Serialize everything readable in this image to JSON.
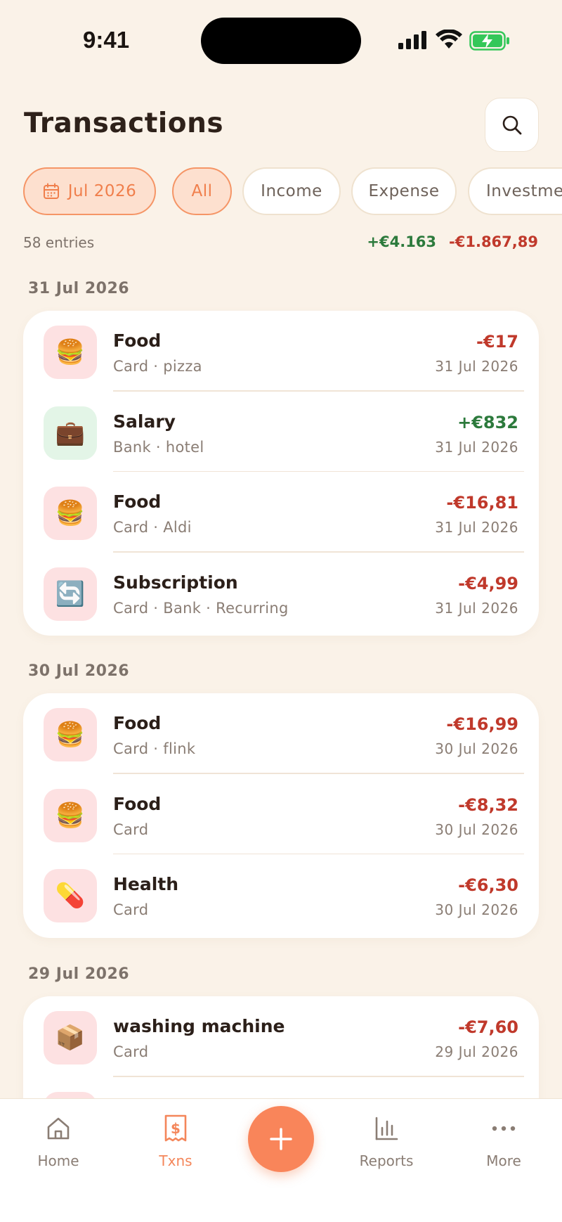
{
  "status_bar": {
    "time": "9:41"
  },
  "header": {
    "title": "Transactions"
  },
  "filters": {
    "month": "Jul 2026",
    "chips": [
      "All",
      "Income",
      "Expense",
      "Investme"
    ]
  },
  "summary": {
    "entries": "58 entries",
    "income": "+€4.163",
    "expense": "-€1.867,89"
  },
  "groups": [
    {
      "date": "31 Jul 2026",
      "items": [
        {
          "icon": "🍔",
          "icon_name": "burger-icon",
          "name": "Food",
          "sub": "Card · pizza",
          "amount": "-€17",
          "type": "neg",
          "date": "31 Jul 2026"
        },
        {
          "icon": "💼",
          "icon_name": "briefcase-icon",
          "name": "Salary",
          "sub": "Bank · hotel",
          "amount": "+€832",
          "type": "pos",
          "date": "31 Jul 2026"
        },
        {
          "icon": "🍔",
          "icon_name": "burger-icon",
          "name": "Food",
          "sub": "Card · Aldi",
          "amount": "-€16,81",
          "type": "neg",
          "date": "31 Jul 2026"
        },
        {
          "icon": "🔄",
          "icon_name": "recurring-icon",
          "name": "Subscription",
          "sub": "Card · Bank · Recurring",
          "amount": "-€4,99",
          "type": "neg",
          "date": "31 Jul 2026"
        }
      ]
    },
    {
      "date": "30 Jul 2026",
      "items": [
        {
          "icon": "🍔",
          "icon_name": "burger-icon",
          "name": "Food",
          "sub": "Card · flink",
          "amount": "-€16,99",
          "type": "neg",
          "date": "30 Jul 2026"
        },
        {
          "icon": "🍔",
          "icon_name": "burger-icon",
          "name": "Food",
          "sub": "Card",
          "amount": "-€8,32",
          "type": "neg",
          "date": "30 Jul 2026"
        },
        {
          "icon": "💊",
          "icon_name": "pill-icon",
          "name": "Health",
          "sub": "Card",
          "amount": "-€6,30",
          "type": "neg",
          "date": "30 Jul 2026"
        }
      ]
    },
    {
      "date": "29 Jul 2026",
      "items": [
        {
          "icon": "📦",
          "icon_name": "package-icon",
          "name": "washing machine",
          "sub": "Card",
          "amount": "-€7,60",
          "type": "neg",
          "date": "29 Jul 2026"
        }
      ]
    }
  ],
  "nav": {
    "home": "Home",
    "txns": "Txns",
    "reports": "Reports",
    "more": "More"
  },
  "colors": {
    "accent": "#f9855a",
    "income": "#2c7a3c",
    "expense": "#c0392b",
    "background": "#faf2e8"
  }
}
